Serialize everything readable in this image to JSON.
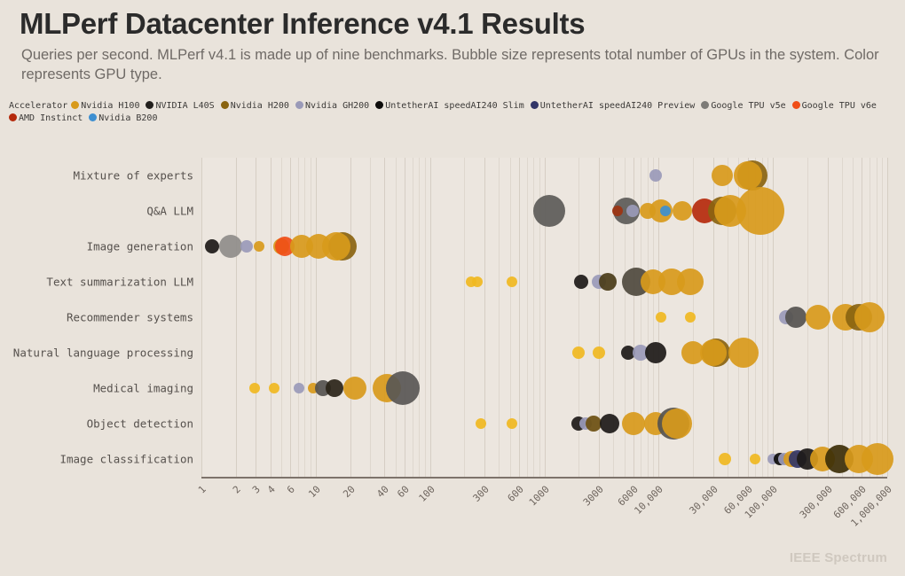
{
  "header": {
    "title": "MLPerf Datacenter Inference v4.1 Results",
    "subtitle": "Queries per second. MLPerf v4.1 is made up of nine benchmarks. Bubble size represents total number of GPUs in the system. Color represents GPU type."
  },
  "legend": {
    "title": "Accelerator",
    "items": [
      {
        "label": "Nvidia H100",
        "color": "#d89a1b"
      },
      {
        "label": "NVIDIA L40S",
        "color": "#221f1c"
      },
      {
        "label": "Nvidia H200",
        "color": "#8a6410"
      },
      {
        "label": "Nvidia GH200",
        "color": "#9a9ab8"
      },
      {
        "label": "UntetherAI speedAI240 Slim",
        "color": "#0d0c0b"
      },
      {
        "label": "UntetherAI speedAI240 Preview",
        "color": "#323567"
      },
      {
        "label": "Google TPU v5e",
        "color": "#7d7b77"
      },
      {
        "label": "Google TPU v6e",
        "color": "#f04e17"
      },
      {
        "label": "AMD Instinct",
        "color": "#b52a0c"
      },
      {
        "label": "Nvidia B200",
        "color": "#3d8fd1"
      }
    ]
  },
  "footer": {
    "brand": "IEEE Spectrum"
  },
  "chart_data": {
    "type": "scatter",
    "title": "MLPerf Datacenter Inference v4.1 Results",
    "subtitle": "Queries per second. MLPerf v4.1 is made up of nine benchmarks. Bubble size represents total number of GPUs in the system. Color represents GPU type.",
    "xlabel": "",
    "ylabel": "",
    "xscale": "log",
    "xlim": [
      1,
      1000000
    ],
    "grid": true,
    "legend_position": "top",
    "size_encoding": "total number of GPUs in the system",
    "color_encoding": "GPU type",
    "xticks": [
      "1",
      "2",
      "3",
      "4",
      "6",
      "10",
      "20",
      "40",
      "60",
      "100",
      "300",
      "600",
      "1000",
      "3000",
      "6000",
      "10,000",
      "30,000",
      "60,000",
      "100,000",
      "300,000",
      "600,000",
      "1,000,000"
    ],
    "xtick_values": [
      1,
      2,
      3,
      4,
      6,
      10,
      20,
      40,
      60,
      100,
      300,
      600,
      1000,
      3000,
      6000,
      10000,
      30000,
      60000,
      100000,
      300000,
      600000,
      1000000
    ],
    "categories": [
      "Mixture of experts",
      "Q&A LLM",
      "Image generation",
      "Text summarization LLM",
      "Recommender systems",
      "Natural language processing",
      "Medical imaging",
      "Object detection",
      "Image classification"
    ],
    "points": [
      {
        "row": "Mixture of experts",
        "accelerator": "Nvidia GH200",
        "color": "#9a9ab8",
        "qps": 9500,
        "r": 7
      },
      {
        "row": "Mixture of experts",
        "accelerator": "Nvidia H100",
        "color": "#d89a1b",
        "qps": 36000,
        "r": 12
      },
      {
        "row": "Mixture of experts",
        "accelerator": "Nvidia H200",
        "color": "#8a6410",
        "qps": 66000,
        "r": 17
      },
      {
        "row": "Mixture of experts",
        "accelerator": "Nvidia H100",
        "color": "#d89a1b",
        "qps": 60000,
        "r": 16
      },
      {
        "row": "Q&A LLM",
        "accelerator": "Google TPU v5e",
        "color": "#5c5b58",
        "qps": 1100,
        "r": 18
      },
      {
        "row": "Q&A LLM",
        "accelerator": "Google TPU v5e",
        "color": "#5c5b58",
        "qps": 5200,
        "r": 15
      },
      {
        "row": "Q&A LLM",
        "accelerator": "AMD Instinct",
        "color": "#9d3310",
        "qps": 4400,
        "r": 6
      },
      {
        "row": "Q&A LLM",
        "accelerator": "Nvidia GH200",
        "color": "#9a9ab8",
        "qps": 5900,
        "r": 7
      },
      {
        "row": "Q&A LLM",
        "accelerator": "Nvidia H100",
        "color": "#d89a1b",
        "qps": 8000,
        "r": 9
      },
      {
        "row": "Q&A LLM",
        "accelerator": "Nvidia H100",
        "color": "#d89a1b",
        "qps": 10500,
        "r": 13
      },
      {
        "row": "Q&A LLM",
        "accelerator": "Nvidia B200",
        "color": "#3d8fd1",
        "qps": 11500,
        "r": 6
      },
      {
        "row": "Q&A LLM",
        "accelerator": "Nvidia H100",
        "color": "#d89a1b",
        "qps": 16000,
        "r": 11
      },
      {
        "row": "Q&A LLM",
        "accelerator": "AMD Instinct",
        "color": "#b52a0c",
        "qps": 25000,
        "r": 14
      },
      {
        "row": "Q&A LLM",
        "accelerator": "Nvidia H200",
        "color": "#8a6410",
        "qps": 36000,
        "r": 16
      },
      {
        "row": "Q&A LLM",
        "accelerator": "Nvidia H100",
        "color": "#d89a1b",
        "qps": 42000,
        "r": 18
      },
      {
        "row": "Q&A LLM",
        "accelerator": "Nvidia H100",
        "color": "#d89a1b",
        "qps": 78000,
        "r": 27
      },
      {
        "row": "Image generation",
        "accelerator": "NVIDIA L40S",
        "color": "#1d1a18",
        "qps": 1.25,
        "r": 8
      },
      {
        "row": "Image generation",
        "accelerator": "Google TPU v5e",
        "color": "#8f8d8a",
        "qps": 1.8,
        "r": 13
      },
      {
        "row": "Image generation",
        "accelerator": "Nvidia GH200",
        "color": "#9a9ab8",
        "qps": 2.5,
        "r": 7
      },
      {
        "row": "Image generation",
        "accelerator": "Nvidia H100",
        "color": "#d89a1b",
        "qps": 3.2,
        "r": 6
      },
      {
        "row": "Image generation",
        "accelerator": "Nvidia H100",
        "color": "#d89a1b",
        "qps": 5.0,
        "r": 9
      },
      {
        "row": "Image generation",
        "accelerator": "Google TPU v6e",
        "color": "#f04e17",
        "qps": 5.4,
        "r": 11
      },
      {
        "row": "Image generation",
        "accelerator": "Nvidia H100",
        "color": "#d89a1b",
        "qps": 7.5,
        "r": 13
      },
      {
        "row": "Image generation",
        "accelerator": "Nvidia H100",
        "color": "#d89a1b",
        "qps": 10.5,
        "r": 14
      },
      {
        "row": "Image generation",
        "accelerator": "Nvidia H200",
        "color": "#8a6410",
        "qps": 17,
        "r": 16
      },
      {
        "row": "Image generation",
        "accelerator": "Nvidia H100",
        "color": "#d89a1b",
        "qps": 15,
        "r": 16
      },
      {
        "row": "Text summarization LLM",
        "accelerator": "Nvidia H100",
        "color": "#f0b821",
        "qps": 230,
        "r": 6
      },
      {
        "row": "Text summarization LLM",
        "accelerator": "Nvidia H100",
        "color": "#f0b821",
        "qps": 260,
        "r": 6
      },
      {
        "row": "Text summarization LLM",
        "accelerator": "Nvidia H100",
        "color": "#f0b821",
        "qps": 520,
        "r": 6
      },
      {
        "row": "Text summarization LLM",
        "accelerator": "NVIDIA L40S",
        "color": "#1d1a18",
        "qps": 2100,
        "r": 8
      },
      {
        "row": "Text summarization LLM",
        "accelerator": "Nvidia GH200",
        "color": "#9a9ab8",
        "qps": 3000,
        "r": 8
      },
      {
        "row": "Text summarization LLM",
        "accelerator": "Nvidia H200",
        "color": "#4a3c18",
        "qps": 3600,
        "r": 10
      },
      {
        "row": "Text summarization LLM",
        "accelerator": "Google TPU v5e",
        "color": "#4f4a3e",
        "qps": 6400,
        "r": 16
      },
      {
        "row": "Text summarization LLM",
        "accelerator": "Nvidia H100",
        "color": "#d89a1b",
        "qps": 9000,
        "r": 14
      },
      {
        "row": "Text summarization LLM",
        "accelerator": "Nvidia H100",
        "color": "#d89a1b",
        "qps": 13000,
        "r": 15
      },
      {
        "row": "Text summarization LLM",
        "accelerator": "Nvidia H100",
        "color": "#d89a1b",
        "qps": 19000,
        "r": 15
      },
      {
        "row": "Recommender systems",
        "accelerator": "Nvidia H100",
        "color": "#f0b821",
        "qps": 10500,
        "r": 6
      },
      {
        "row": "Recommender systems",
        "accelerator": "Nvidia H100",
        "color": "#f0b821",
        "qps": 19000,
        "r": 6
      },
      {
        "row": "Recommender systems",
        "accelerator": "Nvidia GH200",
        "color": "#9a9ab8",
        "qps": 130000,
        "r": 8
      },
      {
        "row": "Recommender systems",
        "accelerator": "Google TPU v5e",
        "color": "#55534f",
        "qps": 160000,
        "r": 12
      },
      {
        "row": "Recommender systems",
        "accelerator": "Nvidia H100",
        "color": "#d89a1b",
        "qps": 250000,
        "r": 14
      },
      {
        "row": "Recommender systems",
        "accelerator": "Nvidia H100",
        "color": "#d89a1b",
        "qps": 430000,
        "r": 15
      },
      {
        "row": "Recommender systems",
        "accelerator": "Nvidia H200",
        "color": "#8a6410",
        "qps": 560000,
        "r": 15
      },
      {
        "row": "Recommender systems",
        "accelerator": "Nvidia H100",
        "color": "#d89a1b",
        "qps": 700000,
        "r": 17
      },
      {
        "row": "Natural language processing",
        "accelerator": "Nvidia H100",
        "color": "#f0b821",
        "qps": 2000,
        "r": 7
      },
      {
        "row": "Natural language processing",
        "accelerator": "Nvidia H100",
        "color": "#f0b821",
        "qps": 3000,
        "r": 7
      },
      {
        "row": "Natural language processing",
        "accelerator": "NVIDIA L40S",
        "color": "#1d1a18",
        "qps": 5400,
        "r": 8
      },
      {
        "row": "Natural language processing",
        "accelerator": "Nvidia GH200",
        "color": "#9a9ab8",
        "qps": 7000,
        "r": 9
      },
      {
        "row": "Natural language processing",
        "accelerator": "NVIDIA L40S",
        "color": "#1d1a18",
        "qps": 9500,
        "r": 12
      },
      {
        "row": "Natural language processing",
        "accelerator": "Nvidia H100",
        "color": "#d89a1b",
        "qps": 20000,
        "r": 13
      },
      {
        "row": "Natural language processing",
        "accelerator": "Nvidia H200",
        "color": "#8a6410",
        "qps": 32000,
        "r": 16
      },
      {
        "row": "Natural language processing",
        "accelerator": "Nvidia H100",
        "color": "#d89a1b",
        "qps": 30000,
        "r": 15
      },
      {
        "row": "Natural language processing",
        "accelerator": "Nvidia H100",
        "color": "#d89a1b",
        "qps": 55000,
        "r": 17
      },
      {
        "row": "Medical imaging",
        "accelerator": "Nvidia H100",
        "color": "#f0b821",
        "qps": 2.9,
        "r": 6
      },
      {
        "row": "Medical imaging",
        "accelerator": "Nvidia H100",
        "color": "#f0b821",
        "qps": 4.3,
        "r": 6
      },
      {
        "row": "Medical imaging",
        "accelerator": "Nvidia GH200",
        "color": "#9a9ab8",
        "qps": 7.2,
        "r": 6
      },
      {
        "row": "Medical imaging",
        "accelerator": "Nvidia H100",
        "color": "#d89a1b",
        "qps": 9.5,
        "r": 6
      },
      {
        "row": "Medical imaging",
        "accelerator": "Google TPU v5e",
        "color": "#55534f",
        "qps": 11.5,
        "r": 9
      },
      {
        "row": "Medical imaging",
        "accelerator": "NVIDIA L40S",
        "color": "#2a2418",
        "qps": 14.5,
        "r": 10
      },
      {
        "row": "Medical imaging",
        "accelerator": "Nvidia H100",
        "color": "#d89a1b",
        "qps": 22,
        "r": 13
      },
      {
        "row": "Medical imaging",
        "accelerator": "Nvidia H100",
        "color": "#d89a1b",
        "qps": 42,
        "r": 16
      },
      {
        "row": "Medical imaging",
        "accelerator": "Google TPU v5e",
        "color": "#595755",
        "qps": 58,
        "r": 19
      },
      {
        "row": "Object detection",
        "accelerator": "Nvidia H100",
        "color": "#f0b821",
        "qps": 280,
        "r": 6
      },
      {
        "row": "Object detection",
        "accelerator": "Nvidia H100",
        "color": "#f0b821",
        "qps": 520,
        "r": 6
      },
      {
        "row": "Object detection",
        "accelerator": "NVIDIA L40S",
        "color": "#1d1a18",
        "qps": 2000,
        "r": 8
      },
      {
        "row": "Object detection",
        "accelerator": "Nvidia GH200",
        "color": "#9a9ab8",
        "qps": 2300,
        "r": 7
      },
      {
        "row": "Object detection",
        "accelerator": "Nvidia H200",
        "color": "#6b4f10",
        "qps": 2700,
        "r": 9
      },
      {
        "row": "Object detection",
        "accelerator": "NVIDIA L40S",
        "color": "#1d1a18",
        "qps": 3700,
        "r": 11
      },
      {
        "row": "Object detection",
        "accelerator": "Nvidia H100",
        "color": "#d89a1b",
        "qps": 6000,
        "r": 13
      },
      {
        "row": "Object detection",
        "accelerator": "Nvidia H100",
        "color": "#d89a1b",
        "qps": 9500,
        "r": 13
      },
      {
        "row": "Object detection",
        "accelerator": "Google TPU v5e",
        "color": "#55534f",
        "qps": 13500,
        "r": 18
      },
      {
        "row": "Object detection",
        "accelerator": "Nvidia H100",
        "color": "#d89a1b",
        "qps": 14500,
        "r": 17
      },
      {
        "row": "Image classification",
        "accelerator": "Nvidia H100",
        "color": "#f0b821",
        "qps": 38000,
        "r": 7
      },
      {
        "row": "Image classification",
        "accelerator": "Nvidia H100",
        "color": "#f0b821",
        "qps": 70000,
        "r": 6
      },
      {
        "row": "Image classification",
        "accelerator": "Nvidia GH200",
        "color": "#9a9ab8",
        "qps": 100000,
        "r": 6
      },
      {
        "row": "Image classification",
        "accelerator": "UntetherAI speedAI240 Slim",
        "color": "#0d0c0b",
        "qps": 115000,
        "r": 7
      },
      {
        "row": "Image classification",
        "accelerator": "Nvidia GH200",
        "color": "#9a9ab8",
        "qps": 125000,
        "r": 7
      },
      {
        "row": "Image classification",
        "accelerator": "Nvidia H100",
        "color": "#d89a1b",
        "qps": 145000,
        "r": 9
      },
      {
        "row": "Image classification",
        "accelerator": "UntetherAI speedAI240 Preview",
        "color": "#323567",
        "qps": 165000,
        "r": 10
      },
      {
        "row": "Image classification",
        "accelerator": "NVIDIA L40S",
        "color": "#1d1a18",
        "qps": 200000,
        "r": 12
      },
      {
        "row": "Image classification",
        "accelerator": "Nvidia H100",
        "color": "#d89a1b",
        "qps": 270000,
        "r": 14
      },
      {
        "row": "Image classification",
        "accelerator": "Nvidia H200",
        "color": "#3d2f08",
        "qps": 380000,
        "r": 16
      },
      {
        "row": "Image classification",
        "accelerator": "Nvidia H100",
        "color": "#d89a1b",
        "qps": 560000,
        "r": 16
      },
      {
        "row": "Image classification",
        "accelerator": "Nvidia H100",
        "color": "#d89a1b",
        "qps": 820000,
        "r": 18
      }
    ]
  }
}
